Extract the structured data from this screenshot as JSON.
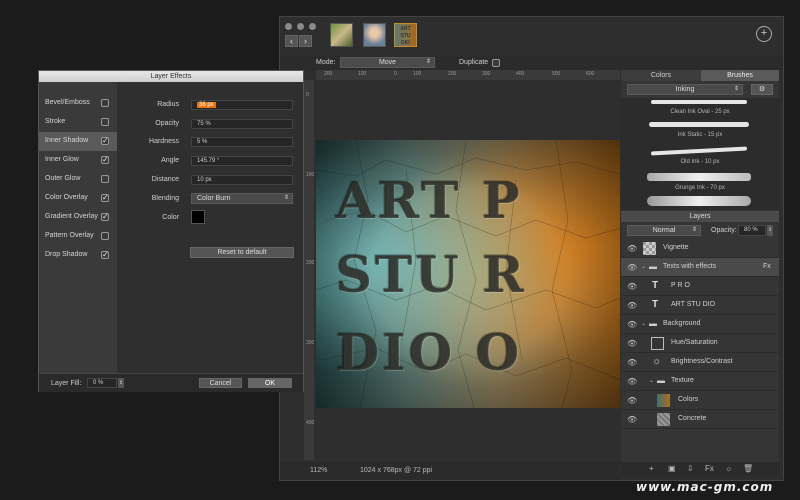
{
  "toolbar": {
    "mode_label": "Mode:",
    "mode_value": "Move",
    "duplicate_label": "Duplicate"
  },
  "rulers": {
    "top_ticks": [
      "200",
      "100",
      "0",
      "100",
      "200",
      "300",
      "400",
      "500",
      "600",
      "700",
      "800"
    ],
    "left_ticks": [
      "0",
      "100",
      "200",
      "300",
      "400",
      "500",
      "600",
      "700",
      "800"
    ]
  },
  "canvas": {
    "lines": [
      "ART P",
      "STU R",
      "DIO O"
    ]
  },
  "status": {
    "zoom": "112%",
    "dimensions": "1024 x 768px @ 72 ppi"
  },
  "right_panel": {
    "tab_colors": "Colors",
    "tab_brushes": "Brushes",
    "brush_set": "Inking",
    "brushes": [
      {
        "name": "Clean Ink Oval - 25 px"
      },
      {
        "name": "Ink Static - 15 px"
      },
      {
        "name": "Old Ink - 10 px"
      },
      {
        "name": "Grunge Ink - 70 px"
      }
    ],
    "layers_title": "Layers",
    "blend_mode": "Normal",
    "opacity_label": "Opacity:",
    "opacity_value": "80 %",
    "layers": [
      {
        "name": "Vignette",
        "type": "image"
      },
      {
        "name": "Texts with effects",
        "type": "group",
        "fx": "Fx"
      },
      {
        "name": "P R O",
        "type": "text"
      },
      {
        "name": "ART STU DIO",
        "type": "text"
      },
      {
        "name": "Background",
        "type": "group"
      },
      {
        "name": "Hue/Saturation",
        "type": "adjust"
      },
      {
        "name": "Brightness/Contrast",
        "type": "adjust"
      },
      {
        "name": "Texture",
        "type": "group"
      },
      {
        "name": "Colors",
        "type": "image"
      },
      {
        "name": "Concrete",
        "type": "image"
      }
    ],
    "bottom_tools": [
      "+",
      "▣",
      "⇩",
      "Fx",
      "☼",
      "🗑"
    ]
  },
  "dialog": {
    "title": "Layer Effects",
    "effects": [
      {
        "name": "Bevel/Emboss",
        "checked": false
      },
      {
        "name": "Stroke",
        "checked": false
      },
      {
        "name": "Inner Shadow",
        "checked": true,
        "selected": true
      },
      {
        "name": "Inner Glow",
        "checked": true
      },
      {
        "name": "Outer Glow",
        "checked": false
      },
      {
        "name": "Color Overlay",
        "checked": true
      },
      {
        "name": "Gradient Overlay",
        "checked": true
      },
      {
        "name": "Pattern Overlay",
        "checked": false
      },
      {
        "name": "Drop Shadow",
        "checked": true
      }
    ],
    "params": {
      "radius_label": "Radius",
      "radius_value": "36 px",
      "opacity_label": "Opacity",
      "opacity_value": "75 %",
      "hardness_label": "Hardness",
      "hardness_value": "5 %",
      "angle_label": "Angle",
      "angle_value": "145.79 °",
      "distance_label": "Distance",
      "distance_value": "10 px",
      "blending_label": "Blending",
      "blending_value": "Color Burn",
      "color_label": "Color",
      "color_hex": "#000000"
    },
    "reset_label": "Reset to default",
    "layer_fill_label": "Layer Fill:",
    "layer_fill_value": "0 %",
    "cancel_label": "Cancel",
    "ok_label": "OK"
  },
  "colors": {
    "highlight": "#e8720c",
    "selected_effect_bg": "#5a5a5a"
  },
  "watermark": "www.mac-gm.com"
}
